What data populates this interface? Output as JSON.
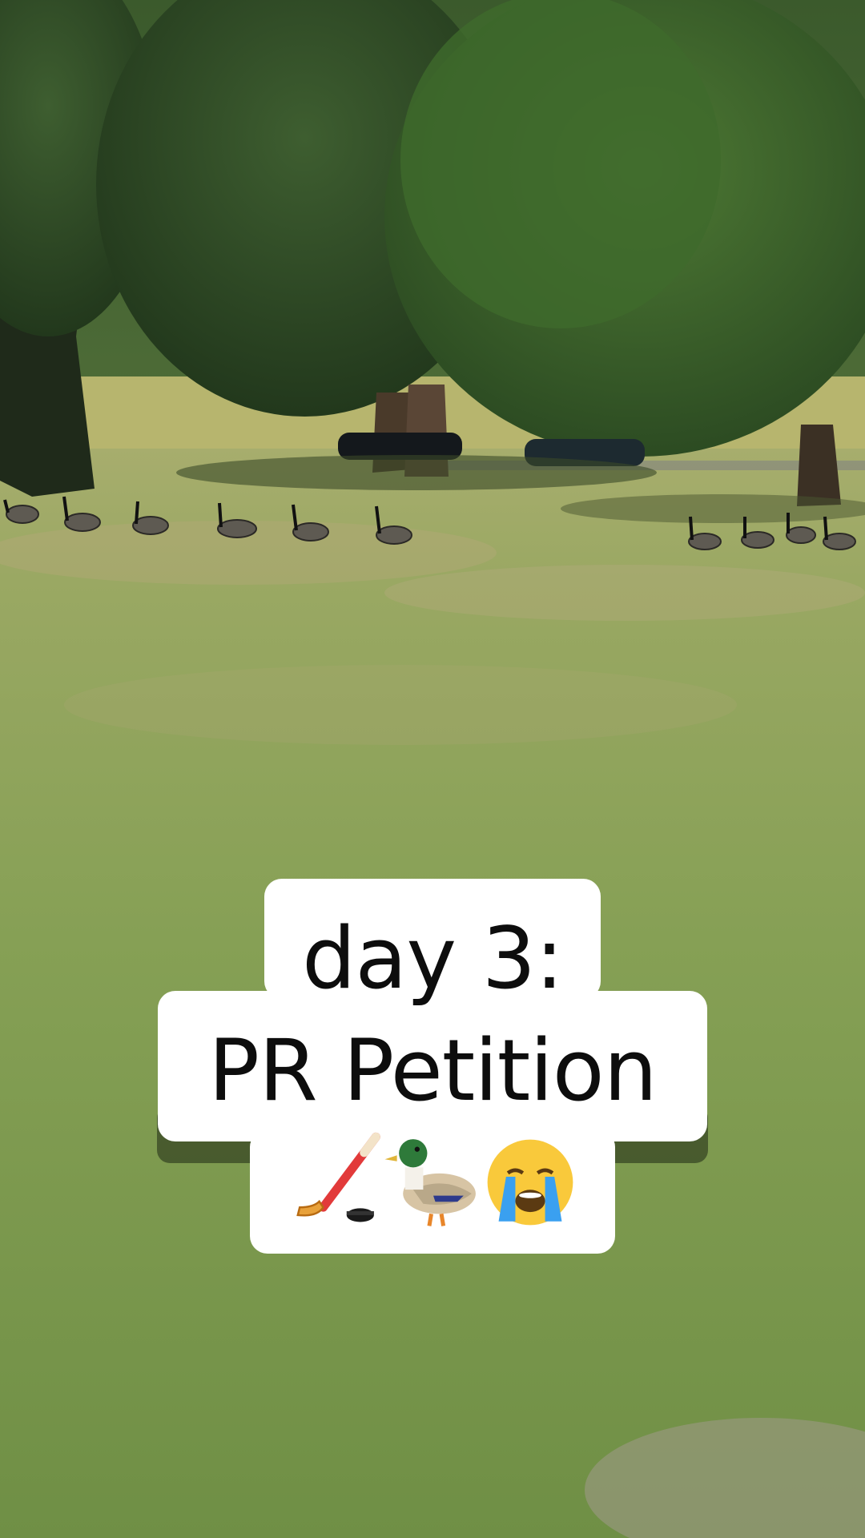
{
  "video_frame": {
    "description_icons": [
      "hockey-stick-icon",
      "duck-icon",
      "crying-face-icon"
    ]
  },
  "caption": {
    "line1": "day 3:",
    "line2": "PR Petition",
    "emojis": [
      "hockey-stick-icon",
      "duck-icon",
      "crying-face-icon"
    ]
  },
  "colors": {
    "caption_bg": "#ffffff",
    "caption_text": "#0d0d0d",
    "grass": "#7f9a52",
    "tree_dark": "#2f4a25"
  }
}
